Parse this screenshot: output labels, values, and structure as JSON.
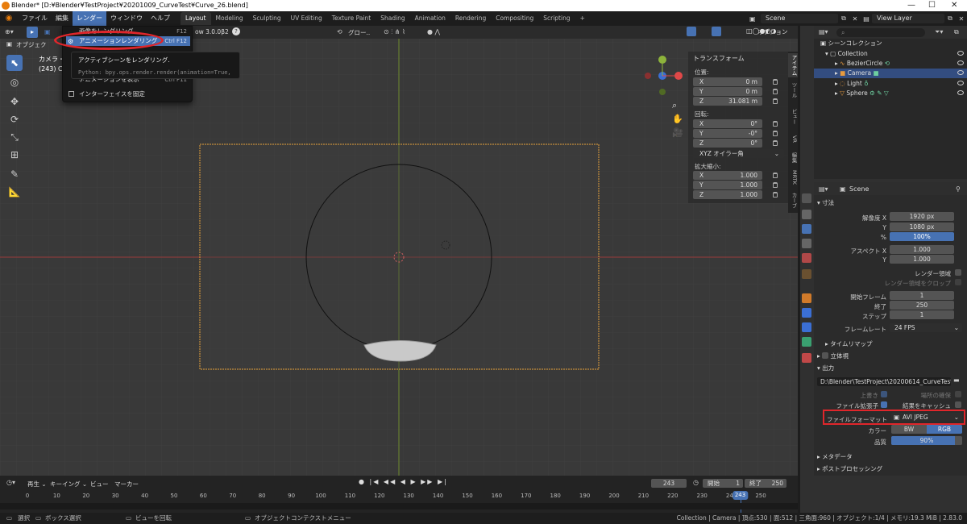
{
  "titlebar": {
    "title": "Blender* [D:¥Blender¥TestProject¥20201009_CurveTest¥Curve_26.blend]",
    "minimize": "—",
    "maximize": "☐",
    "close": "✕"
  },
  "menubar": {
    "items": [
      "ファイル",
      "編集",
      "レンダー",
      "ウィンドウ",
      "ヘルプ"
    ],
    "active_index": 2
  },
  "workspaces": {
    "tabs": [
      "Layout",
      "Modeling",
      "Sculpting",
      "UV Editing",
      "Texture Paint",
      "Shading",
      "Animation",
      "Rendering",
      "Compositing",
      "Scripting"
    ],
    "active_index": 0,
    "add": "+"
  },
  "scene": {
    "label": "Scene",
    "view_layer": "View Layer"
  },
  "render_menu": {
    "items": [
      {
        "label": "画像をレンダリング",
        "shortcut": "F12"
      },
      {
        "label": "アニメーションレンダリング",
        "shortcut": "Ctrl F12"
      },
      {
        "label": "アニメーションを表示",
        "shortcut": "Ctrl F11"
      },
      {
        "label": "インターフェイスを固定",
        "shortcut": ""
      }
    ]
  },
  "tooltip": {
    "title": "アクティブシーンをレンダリング.",
    "python": "Python: bpy.ops.render.render(animation=True, ... )"
  },
  "viewport": {
    "header_left": "オブジェク",
    "info_line1": "カメラ・ジ",
    "info_line2": "(243) Col",
    "header_right_partial": "ow 3.0.0β2",
    "global": "グロー..",
    "options": "オプション"
  },
  "npanel": {
    "title": "トランスフォーム",
    "location_label": "位置:",
    "location": [
      {
        "axis": "X",
        "value": "0 m"
      },
      {
        "axis": "Y",
        "value": "0 m"
      },
      {
        "axis": "Z",
        "value": "31.081 m"
      }
    ],
    "rotation_label": "回転:",
    "rotation": [
      {
        "axis": "X",
        "value": "0°"
      },
      {
        "axis": "Y",
        "value": "-0°"
      },
      {
        "axis": "Z",
        "value": "0°"
      }
    ],
    "rotation_mode": "XYZ オイラー角",
    "scale_label": "拡大縮小:",
    "scale": [
      {
        "axis": "X",
        "value": "1.000"
      },
      {
        "axis": "Y",
        "value": "1.000"
      },
      {
        "axis": "Z",
        "value": "1.000"
      }
    ],
    "side_tabs": [
      "アイテム",
      "ツール",
      "ビュー",
      "VR",
      "編集",
      "MRTK",
      "カーブ"
    ]
  },
  "outliner": {
    "title": "シーンコレクション",
    "rows": [
      {
        "label": "Collection",
        "indent": 1,
        "selected": false
      },
      {
        "label": "BezierCircle",
        "indent": 2,
        "selected": false
      },
      {
        "label": "Camera",
        "indent": 2,
        "selected": true
      },
      {
        "label": "Light",
        "indent": 2,
        "selected": false
      },
      {
        "label": "Sphere",
        "indent": 2,
        "selected": false
      }
    ]
  },
  "properties": {
    "scene_label": "Scene",
    "dimensions_section": "寸法",
    "resolution_x_label": "解像度 X",
    "resolution_x": "1920 px",
    "resolution_y_label": "Y",
    "resolution_y": "1080 px",
    "percent_label": "%",
    "percent": "100%",
    "aspect_x_label": "アスペクト X",
    "aspect_x": "1.000",
    "aspect_y_label": "Y",
    "aspect_y": "1.000",
    "render_region": "レンダー領域",
    "crop_region": "レンダー領域をクロップ",
    "frame_start_label": "開始フレーム",
    "frame_start": "1",
    "frame_end_label": "終了",
    "frame_end": "250",
    "frame_step_label": "ステップ",
    "frame_step": "1",
    "frame_rate_label": "フレームレート",
    "frame_rate": "24 FPS",
    "time_remap": "タイムリマップ",
    "stereoscopy": "立体視",
    "output_section": "出力",
    "output_path": "D:\\Blender\\TestProject\\20200614_CurveTest\\",
    "overwrite": "上書き",
    "placeholders": "場所の確保",
    "file_ext": "ファイル拡張子",
    "cache_result": "結果をキャッシュ",
    "file_format_label": "ファイルフォーマット",
    "file_format": "AVI JPEG",
    "color_label": "カラー",
    "color_bw": "BW",
    "color_rgb": "RGB",
    "quality_label": "品質",
    "quality": "90%",
    "metadata": "メタデータ",
    "post_processing": "ポストプロセッシング"
  },
  "timeline": {
    "menu": [
      "再生",
      "キーイング",
      "ビュー",
      "マーカー"
    ],
    "current_frame": "243",
    "start_label": "開始",
    "start": "1",
    "end_label": "終了",
    "end": "250",
    "ticks": [
      "0",
      "10",
      "20",
      "30",
      "40",
      "50",
      "60",
      "70",
      "80",
      "90",
      "100",
      "110",
      "120",
      "130",
      "140",
      "150",
      "160",
      "170",
      "180",
      "190",
      "200",
      "210",
      "220",
      "230",
      "240",
      "250"
    ],
    "playhead": "243"
  },
  "statusbar": {
    "select": "選択",
    "box_select": "ボックス選択",
    "rotate_view": "ビューを回転",
    "context_menu": "オブジェクトコンテクストメニュー",
    "stats": "Collection | Camera | 頂点:530 | 面:512 | 三角面:960 | オブジェクト:1/4 | メモリ:19.3 MiB | 2.83.0"
  },
  "colors": {
    "accent": "#4772b3",
    "highlight_red": "#e0262b",
    "camera_frame": "#e6a23c",
    "x_axis": "#c0392b",
    "y_axis": "#8db33b"
  }
}
